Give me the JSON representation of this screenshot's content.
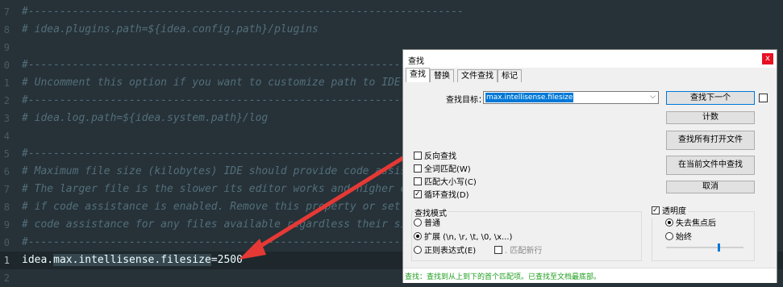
{
  "editor": {
    "lines": [
      {
        "num": "7",
        "text": "#---------------------------------------------------------------------"
      },
      {
        "num": "8",
        "text": "# idea.plugins.path=${idea.config.path}/plugins"
      },
      {
        "num": "9",
        "text": ""
      },
      {
        "num": "0",
        "text": "#---------------------------------------------------------------------"
      },
      {
        "num": "1",
        "text": "# Uncomment this option if you want to customize path to IDE logs"
      },
      {
        "num": "2",
        "text": "#---------------------------------------------------------------------"
      },
      {
        "num": "3",
        "text": "# idea.log.path=${idea.system.path}/log"
      },
      {
        "num": "4",
        "text": ""
      },
      {
        "num": "5",
        "text": "#---------------------------------------------------------------------"
      },
      {
        "num": "6",
        "text": "# Maximum file size (kilobytes) IDE should provide code assistance"
      },
      {
        "num": "7",
        "text": "# The larger file is the slower its editor works and higher overall"
      },
      {
        "num": "8",
        "text": "# if code assistance is enabled. Remove this property or set to very"
      },
      {
        "num": "9",
        "text": "# code assistance for any files available regardless their size."
      },
      {
        "num": "0",
        "text": "#---------------------------------------------------------------------"
      }
    ],
    "active_line": {
      "num": "1",
      "parts": [
        "idea.",
        "max.intellisense.filesize",
        "=2500"
      ]
    },
    "last_line_num": "2"
  },
  "dialog": {
    "title": "查找",
    "close_glyph": "x",
    "tabs": [
      "查找",
      "替换",
      "文件查找",
      "标记"
    ],
    "find_label": "查找目标：",
    "find_value": "max.intellisense.filesize",
    "buttons": {
      "find_next": "查找下一个",
      "count": "计数",
      "find_all_open": "查找所有打开文件",
      "find_in_current": "在当前文件中查找",
      "cancel": "取消"
    },
    "options": [
      {
        "label": "反向查找",
        "checked": false
      },
      {
        "label": "全词匹配(W)",
        "checked": false
      },
      {
        "label": "匹配大小写(C)",
        "checked": false
      },
      {
        "label": "循环查找(D)",
        "checked": true
      }
    ],
    "search_mode": {
      "label": "查找模式",
      "normal": "普通",
      "extended": "扩展 (\\n, \\r, \\t, \\0, \\x...)",
      "regex": "正则表达式(E)",
      "dot_newline": ". 匹配新行"
    },
    "transparency": {
      "label": "透明度",
      "on_lose_focus": "失去焦点后",
      "always": "始终"
    },
    "status": "查找：查找到从上到下的首个匹配项。已查找至文档最底部。"
  },
  "colors": {
    "editor_bg": "#263238",
    "comment": "#546e7a",
    "arrow": "#e53935",
    "status_green": "#1e9e1e"
  }
}
